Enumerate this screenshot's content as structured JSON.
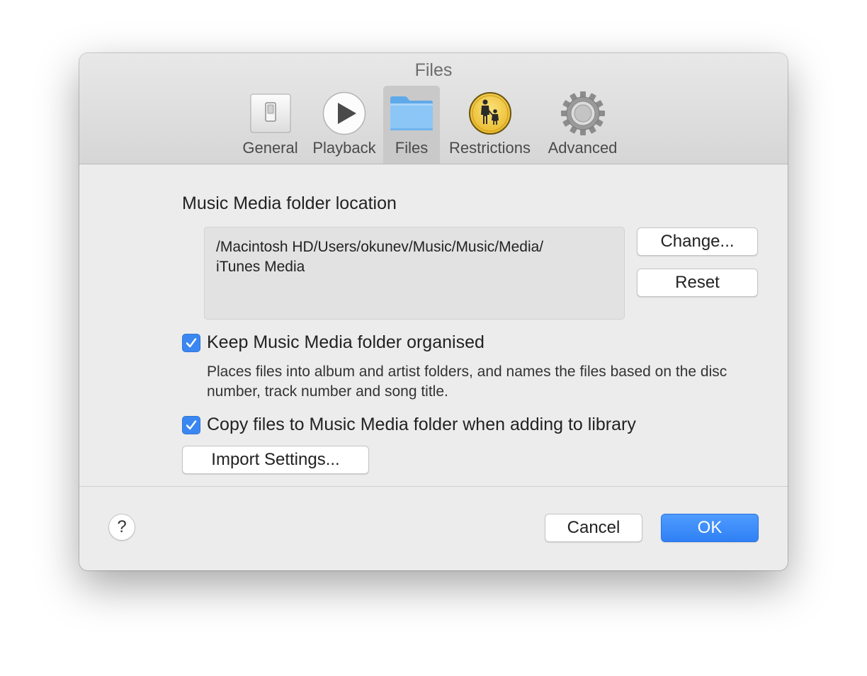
{
  "window": {
    "title": "Files"
  },
  "toolbar": {
    "tabs": [
      {
        "label": "General",
        "icon": "switch-icon"
      },
      {
        "label": "Playback",
        "icon": "play-icon"
      },
      {
        "label": "Files",
        "icon": "folder-icon",
        "selected": true
      },
      {
        "label": "Restrictions",
        "icon": "parental-icon"
      },
      {
        "label": "Advanced",
        "icon": "gear-icon"
      }
    ]
  },
  "files": {
    "section_label": "Music Media folder location",
    "path_line1": "/Macintosh HD/Users/okunev/Music/Music/Media/",
    "path_line2": "iTunes Media",
    "change_label": "Change...",
    "reset_label": "Reset",
    "keep_organised": {
      "label": "Keep Music Media folder organised",
      "checked": true
    },
    "description": "Places files into album and artist folders, and names the files based on the disc number, track number and song title.",
    "copy_files": {
      "label": "Copy files to Music Media folder when adding to library",
      "checked": true
    },
    "import_settings_label": "Import Settings..."
  },
  "footer": {
    "help_label": "?",
    "cancel_label": "Cancel",
    "ok_label": "OK"
  },
  "colors": {
    "accent": "#3a87f2",
    "window_bg": "#ececec",
    "toolbar_selected": "#c9c9c9"
  }
}
